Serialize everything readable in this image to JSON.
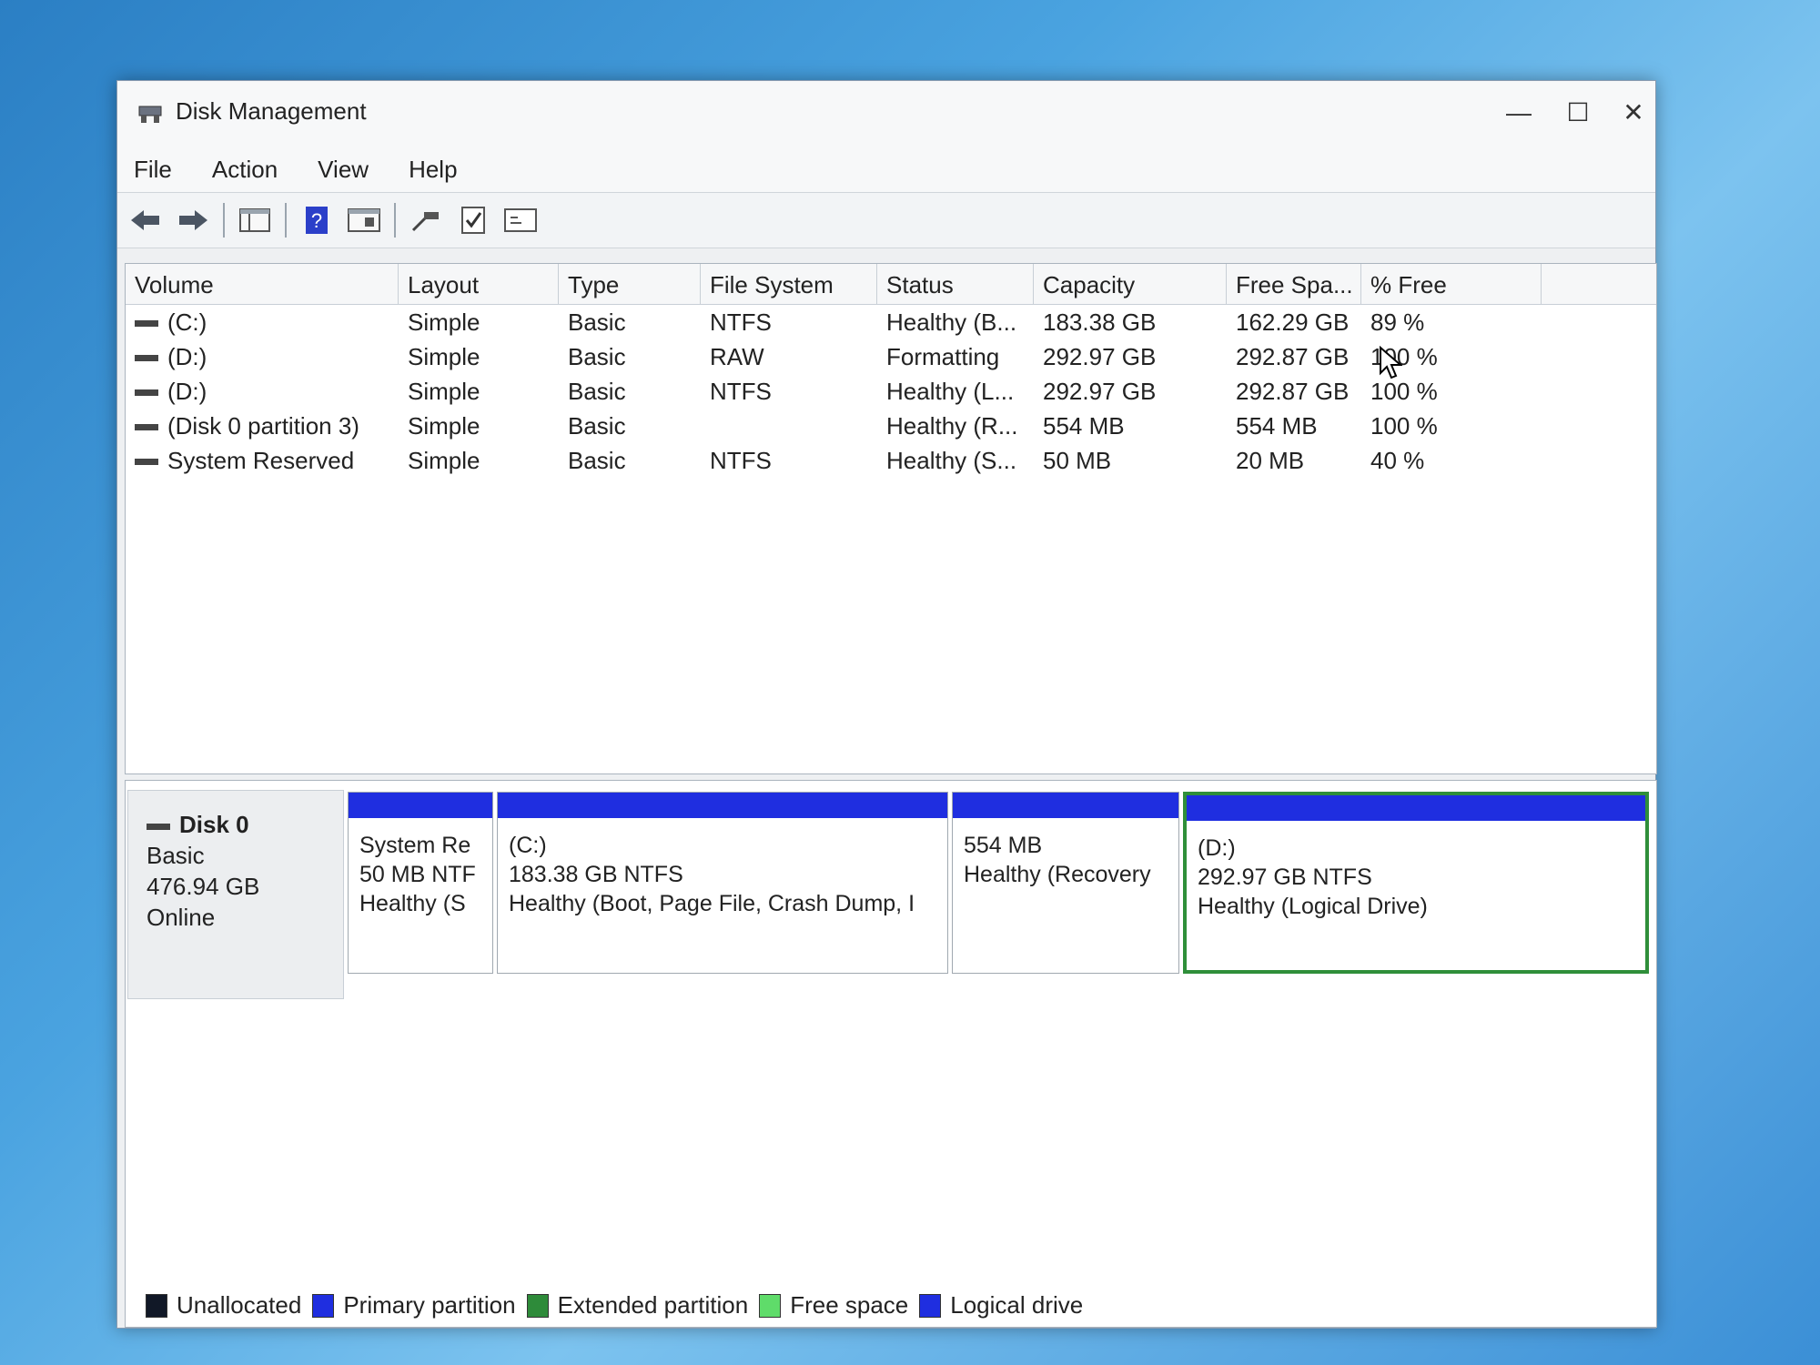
{
  "window": {
    "title": "Disk Management",
    "minimize": "—",
    "maximize": "☐",
    "close": "✕"
  },
  "menu": [
    "File",
    "Action",
    "View",
    "Help"
  ],
  "toolbar": [
    "back-icon",
    "forward-icon",
    "console-tree-icon",
    "help-icon",
    "properties-icon",
    "connect-icon",
    "check-icon",
    "settings-icon"
  ],
  "columns": [
    "Volume",
    "Layout",
    "Type",
    "File System",
    "Status",
    "Capacity",
    "Free Spa...",
    "% Free"
  ],
  "rows": [
    [
      "(C:)",
      "Simple",
      "Basic",
      "NTFS",
      "Healthy (B...",
      "183.38 GB",
      "162.29 GB",
      "89 %"
    ],
    [
      "(D:)",
      "Simple",
      "Basic",
      "RAW",
      "Formatting",
      "292.97 GB",
      "292.87 GB",
      "100 %"
    ],
    [
      "(D:)",
      "Simple",
      "Basic",
      "NTFS",
      "Healthy (L...",
      "292.97 GB",
      "292.87 GB",
      "100 %"
    ],
    [
      "(Disk 0 partition 3)",
      "Simple",
      "Basic",
      "",
      "Healthy (R...",
      "554 MB",
      "554 MB",
      "100 %"
    ],
    [
      "System Reserved",
      "Simple",
      "Basic",
      "NTFS",
      "Healthy (S...",
      "50 MB",
      "20 MB",
      "40 %"
    ]
  ],
  "disk": {
    "name": "Disk 0",
    "type": "Basic",
    "size": "476.94 GB",
    "state": "Online"
  },
  "partitions": [
    {
      "name": "System Re",
      "size": "50 MB NTF",
      "status": "Healthy (S"
    },
    {
      "name": "(C:)",
      "size": "183.38 GB NTFS",
      "status": "Healthy (Boot, Page File, Crash Dump, I"
    },
    {
      "name": "",
      "size": "554 MB",
      "status": "Healthy (Recovery"
    },
    {
      "name": "(D:)",
      "size": "292.97 GB NTFS",
      "status": "Healthy (Logical Drive)"
    }
  ],
  "legend": [
    {
      "label": "Unallocated",
      "color": "#111827"
    },
    {
      "label": "Primary partition",
      "color": "#1f2ee0"
    },
    {
      "label": "Extended partition",
      "color": "#2e8b3a"
    },
    {
      "label": "Free space",
      "color": "#5fdc6a"
    },
    {
      "label": "Logical drive",
      "color": "#1f2ee0"
    }
  ]
}
